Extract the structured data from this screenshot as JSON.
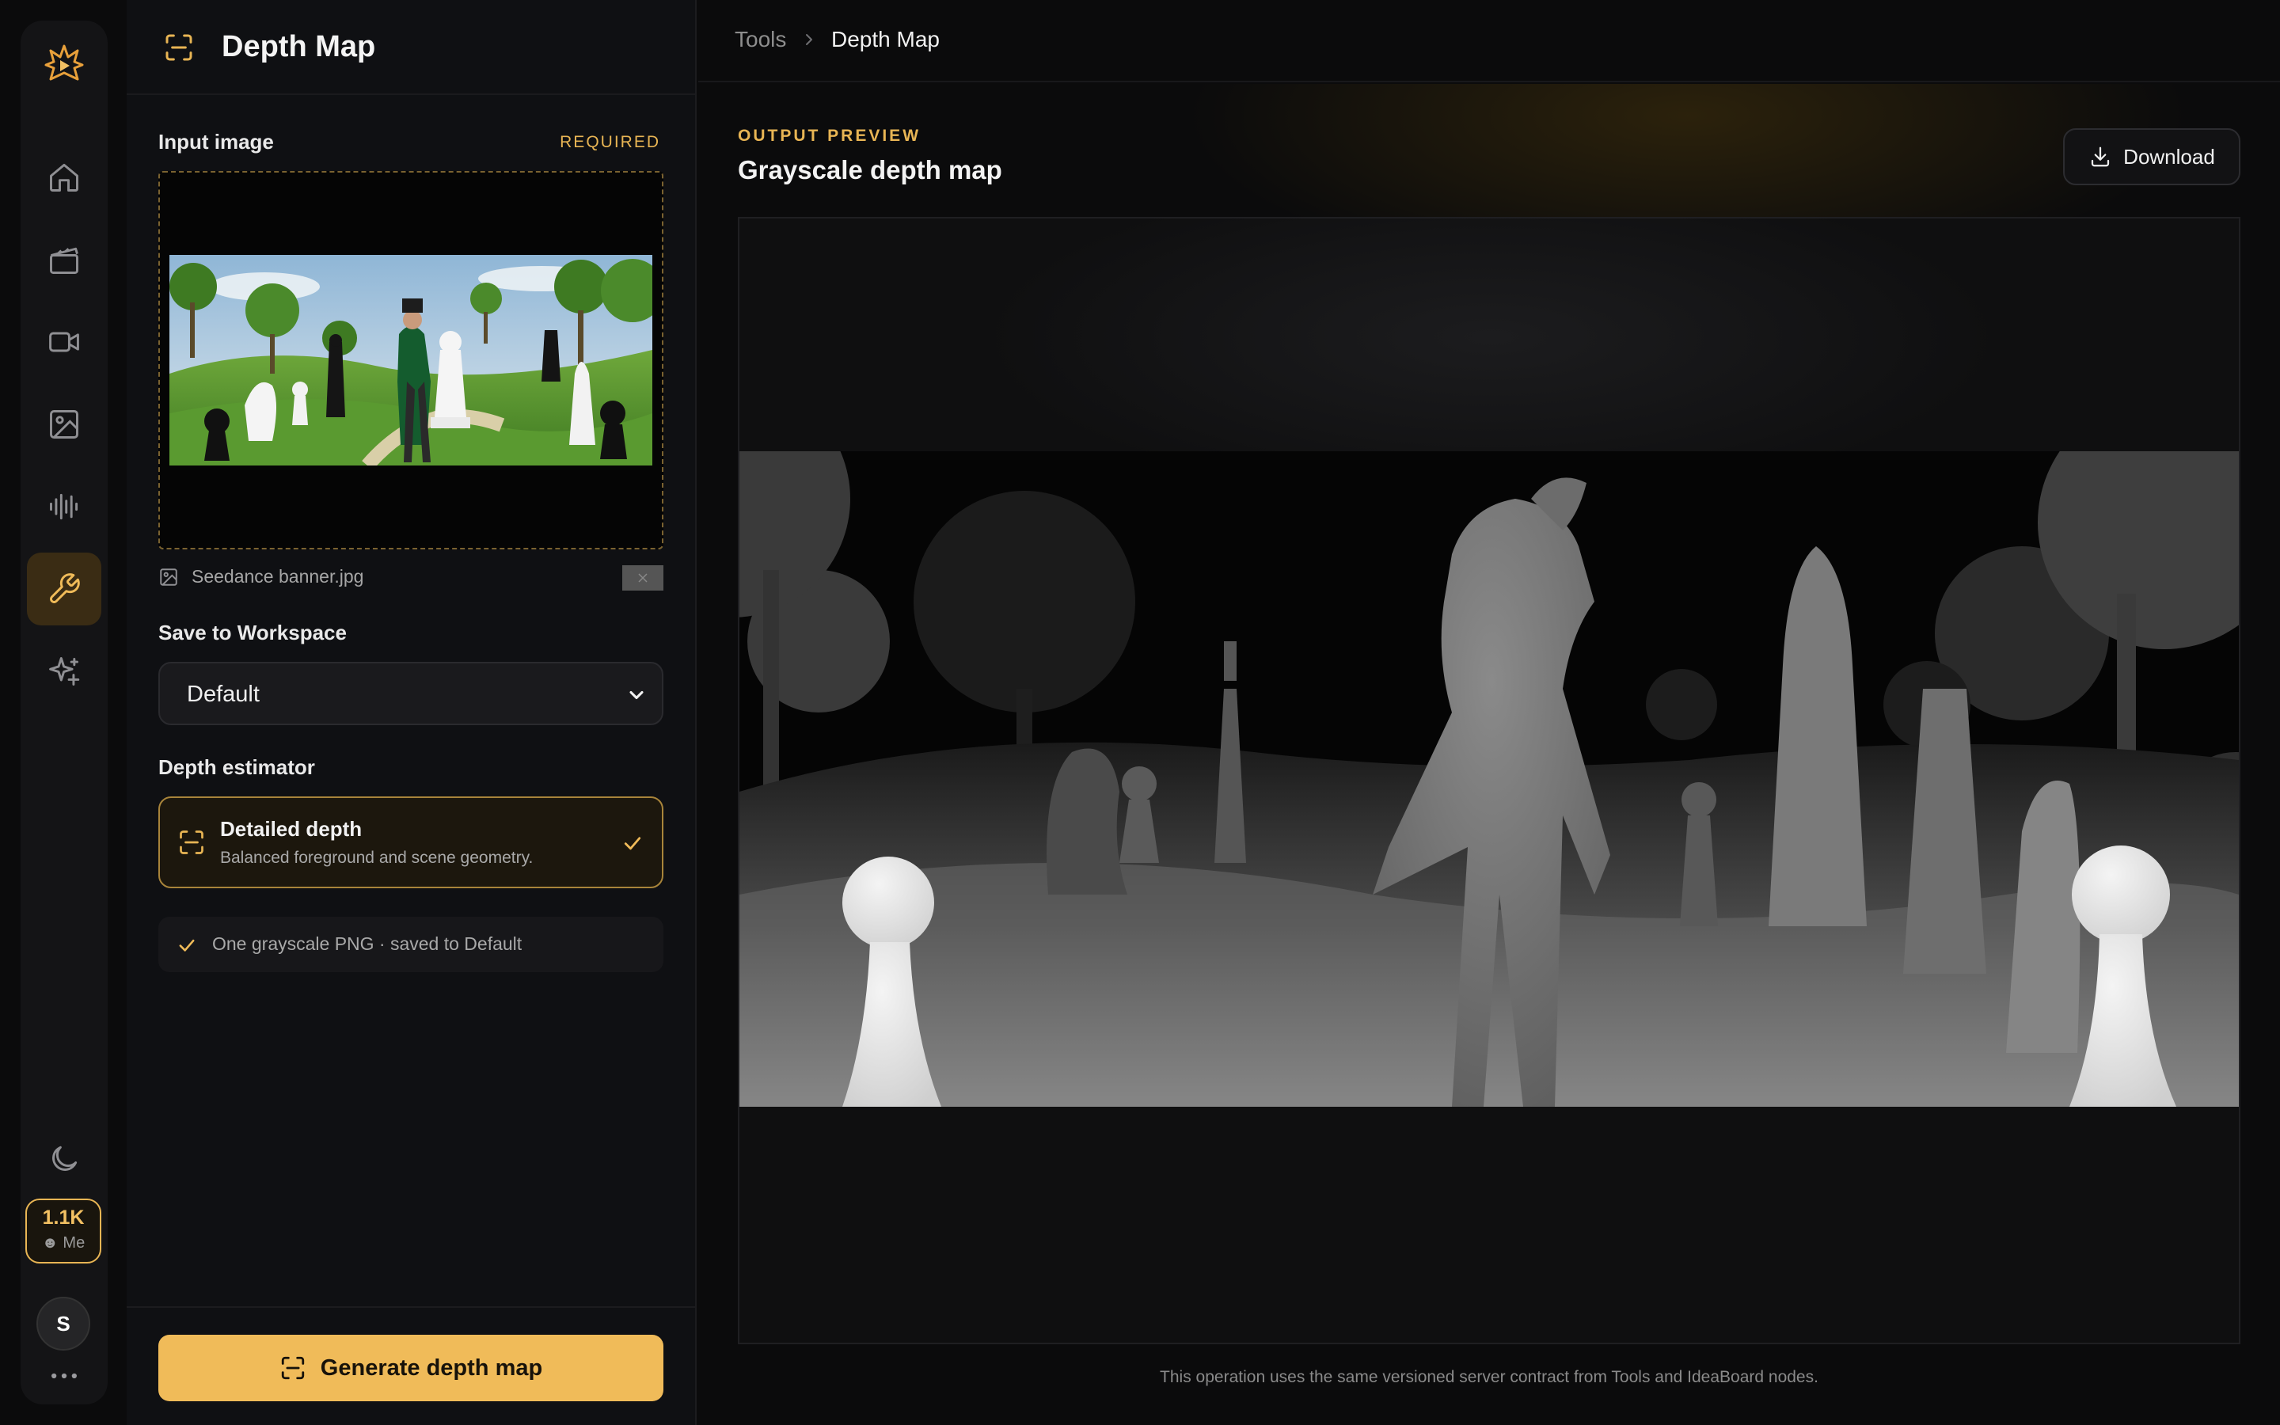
{
  "app": {
    "page_title": "Depth Map"
  },
  "sidebar": {
    "items": [
      {
        "name": "home",
        "icon": "home-icon"
      },
      {
        "name": "projects",
        "icon": "clapperboard-icon"
      },
      {
        "name": "video",
        "icon": "video-icon"
      },
      {
        "name": "image",
        "icon": "image-icon"
      },
      {
        "name": "audio",
        "icon": "waveform-icon"
      },
      {
        "name": "tools",
        "icon": "wrench-icon",
        "active": true
      },
      {
        "name": "ai",
        "icon": "sparkles-icon"
      }
    ],
    "credits": "1.1K",
    "credits_owner": "Me",
    "avatar_initial": "S",
    "more_icon": "more-icon",
    "theme_icon": "moon-icon"
  },
  "panel": {
    "input_label": "Input image",
    "required_label": "REQUIRED",
    "file_name": "Seedance banner.jpg",
    "workspace_label": "Save to Workspace",
    "workspace_value": "Default",
    "estimator_label": "Depth estimator",
    "estimator_option": {
      "title": "Detailed depth",
      "description": "Balanced foreground and scene geometry.",
      "selected": true
    },
    "output_note": "One grayscale PNG · saved to Default",
    "generate_label": "Generate depth map"
  },
  "breadcrumb": {
    "root": "Tools",
    "current": "Depth Map"
  },
  "preview": {
    "kicker": "OUTPUT PREVIEW",
    "title": "Grayscale depth map",
    "download_label": "Download"
  },
  "footer": {
    "note": "This operation uses the same versioned server contract from Tools and IdeaBoard nodes."
  },
  "colors": {
    "accent": "#f0bb59",
    "background": "#0b0b0c",
    "panel": "#0f1013"
  }
}
